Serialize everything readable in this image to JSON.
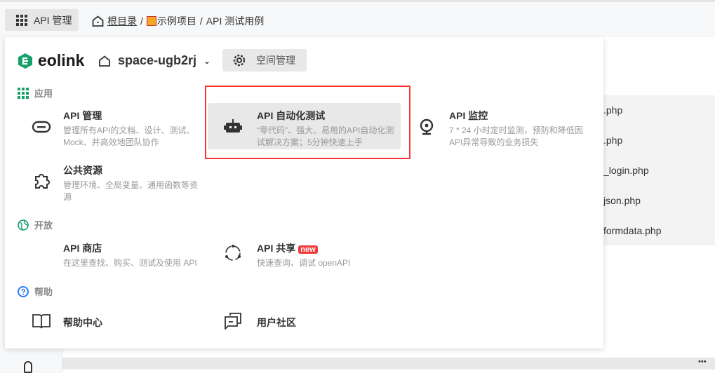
{
  "topbar": {
    "app_button": "API 管理",
    "breadcrumb": [
      "根目录",
      "示例项目",
      "API 测试用例"
    ],
    "separator": "/"
  },
  "background": {
    "rows": [
      ".php",
      ".php",
      "_login.php",
      "json.php",
      "formdata.php"
    ],
    "more": "•••"
  },
  "panel": {
    "logo": "eolink",
    "space_name": "space-ugb2rj",
    "space_settings": "空间管理",
    "sections": [
      {
        "label": "应用",
        "icon": "grid-icon",
        "color": "#16a06a",
        "items": [
          {
            "title": "API 管理",
            "desc": "管理所有API的文档、设计、测试、Mock、并高效地团队协作",
            "icon": "link-icon"
          },
          {
            "title": "API 自动化测试",
            "desc": "“零代码”、强大、易用的API自动化测试解决方案；5分钟快速上手",
            "icon": "robot-icon",
            "highlighted": true
          },
          {
            "title": "API 监控",
            "desc": "7 * 24 小时定时监测，预防和降低因API异常导致的业务损失",
            "icon": "webcam-icon"
          },
          {
            "title": "公共资源",
            "desc": "管理环境、全局变量、通用函数等资源",
            "icon": "puzzle-icon"
          }
        ]
      },
      {
        "label": "开放",
        "icon": "globe-icon",
        "color": "#16a06a",
        "items": [
          {
            "title": "API 商店",
            "desc": "在这里查找、购买、测试及使用 API"
          },
          {
            "title": "API 共享",
            "badge": "new",
            "desc": "快速查询、调试 openAPI",
            "icon": "share-icon"
          }
        ]
      },
      {
        "label": "帮助",
        "icon": "help-icon",
        "color": "#2f7bf5",
        "items": [
          {
            "title": "帮助中心",
            "icon": "book-icon"
          },
          {
            "title": "用户社区",
            "icon": "chat-icon"
          }
        ]
      }
    ]
  },
  "colors": {
    "accent": "#16a06a",
    "highlight_border": "#ff3333",
    "badge": "#f03c3c"
  }
}
